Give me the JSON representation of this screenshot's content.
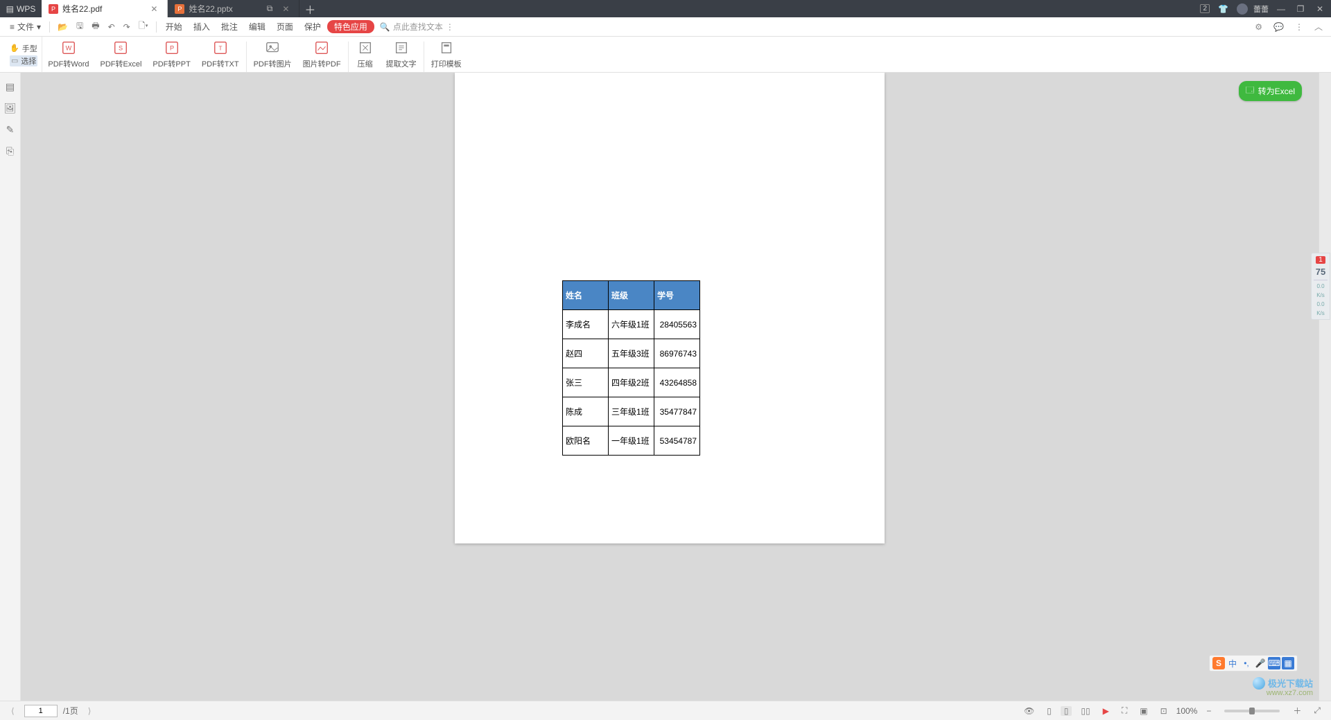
{
  "titlebar": {
    "logo": "WPS",
    "tabs": [
      {
        "icon": "pdf",
        "label": "姓名22.pdf",
        "active": true
      },
      {
        "icon": "ppt",
        "label": "姓名22.pptx",
        "active": false
      }
    ],
    "notif_badge": "2",
    "user": "蕾蕾"
  },
  "menubar": {
    "file": "文件",
    "items": [
      "开始",
      "插入",
      "批注",
      "编辑",
      "页面",
      "保护"
    ],
    "accent": "特色应用",
    "search_placeholder": "点此查找文本"
  },
  "ribbon": {
    "hand": "手型",
    "select": "选择",
    "buttons": [
      "PDF转Word",
      "PDF转Excel",
      "PDF转PPT",
      "PDF转TXT",
      "PDF转图片",
      "图片转PDF",
      "压缩",
      "提取文字",
      "打印模板"
    ]
  },
  "convert_button": "转为Excel",
  "table": {
    "headers": [
      "姓名",
      "班级",
      "学号"
    ],
    "rows": [
      {
        "name": "李成名",
        "cls": "六年级1班",
        "num": "28405563"
      },
      {
        "name": "赵四",
        "cls": "五年级3班",
        "num": "86976743"
      },
      {
        "name": "张三",
        "cls": "四年级2班",
        "num": "43264858"
      },
      {
        "name": "陈成",
        "cls": "三年级1班",
        "num": "35477847"
      },
      {
        "name": "欧阳名",
        "cls": "一年级1班",
        "num": "53454787"
      }
    ]
  },
  "right_float": {
    "badge": "1",
    "score": "75",
    "rate1": "0.0",
    "unit1": "K/s",
    "rate2": "0.0",
    "unit2": "K/s"
  },
  "status": {
    "page_input": "1",
    "page_total": "/1页",
    "zoom": "100%"
  },
  "ime": {
    "logo": "S",
    "zh": "中"
  },
  "watermark": {
    "brand": "极光下载站",
    "url": "www.xz7.com"
  }
}
